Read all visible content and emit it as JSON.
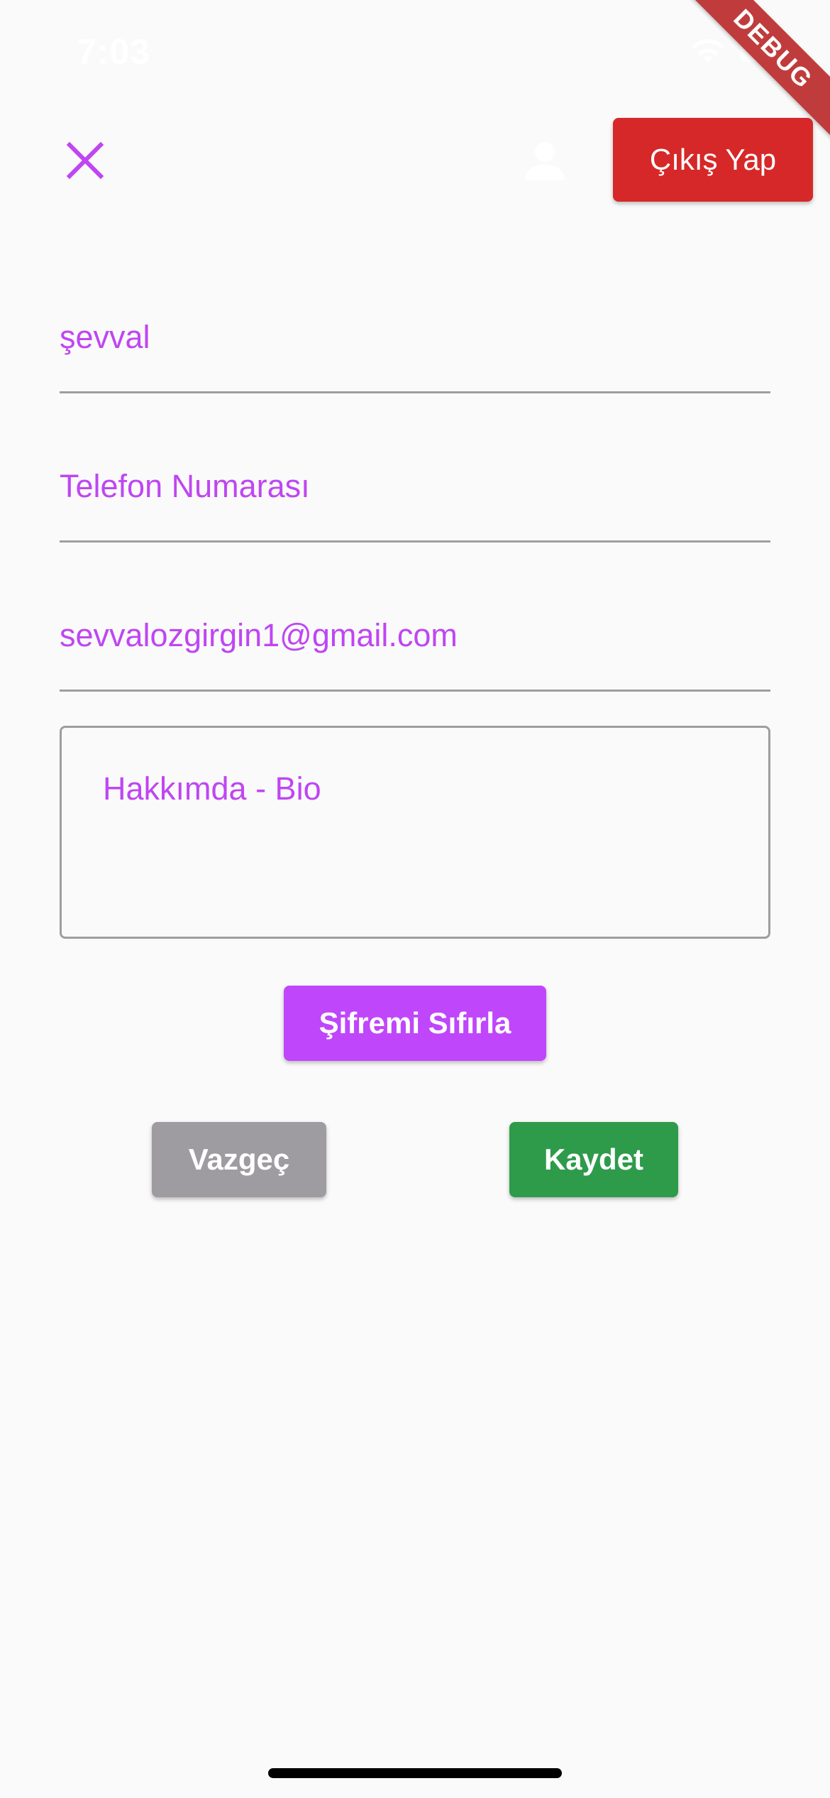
{
  "status_bar": {
    "time": "7:03"
  },
  "debug_banner": "DEBUG",
  "header": {
    "close_icon": "close-icon",
    "avatar_icon": "person-icon",
    "logout_label": "Çıkış Yap"
  },
  "form": {
    "name_value": "şevval",
    "phone_placeholder": "Telefon Numarası",
    "email_value": "sevvalozgirgin1@gmail.com",
    "bio_placeholder": "Hakkımda - Bio"
  },
  "actions": {
    "reset_password_label": "Şifremi Sıfırla",
    "cancel_label": "Vazgeç",
    "save_label": "Kaydet"
  },
  "colors": {
    "accent_purple": "#bf46fb",
    "logout_red": "#d62828",
    "save_green": "#2e9b4a",
    "cancel_gray": "#9e9ba1"
  }
}
